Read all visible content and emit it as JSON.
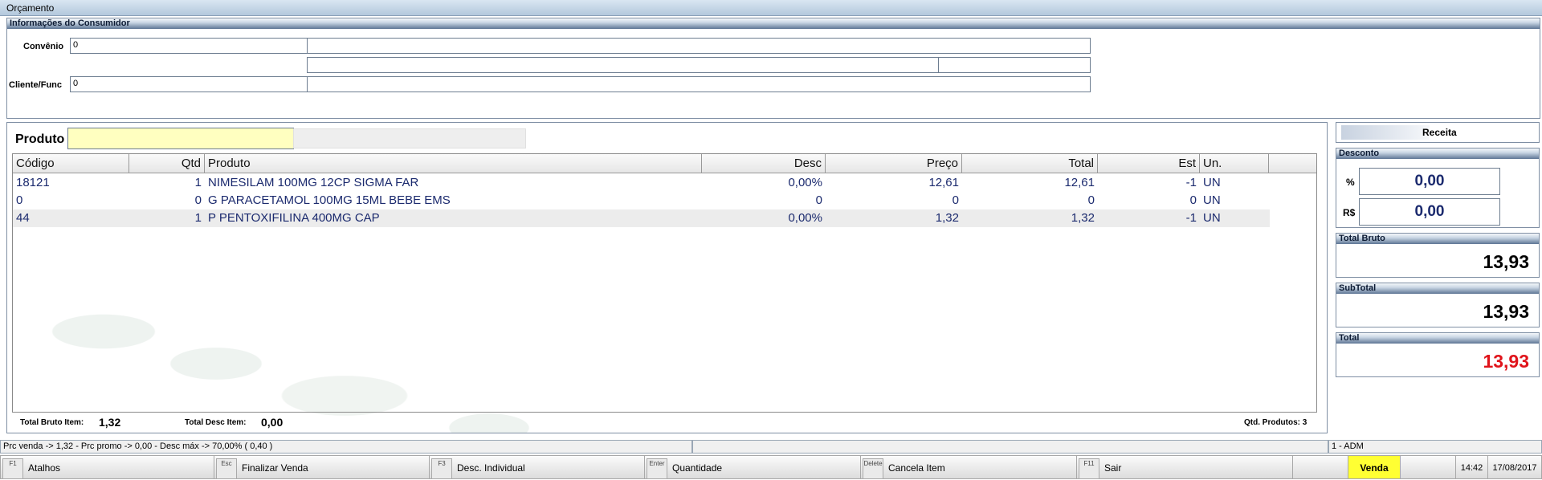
{
  "window": {
    "title": "Orçamento"
  },
  "consumer": {
    "header": "Informações do Consumidor",
    "convenio_label": "Convênio",
    "convenio_value": "0",
    "cliente_label": "Cliente/Func",
    "cliente_value": "0"
  },
  "produto": {
    "label": "Produto",
    "value": ""
  },
  "table": {
    "columns": [
      "Código",
      "Qtd",
      "Produto",
      "Desc",
      "Preço",
      "Total",
      "Est",
      "Un."
    ],
    "rows": [
      [
        "18121",
        "1",
        "NIMESILAM 100MG 12CP SIGMA FAR",
        "0,00%",
        "12,61",
        "12,61",
        "-1",
        "UN"
      ],
      [
        "0",
        "0",
        "G PARACETAMOL 100MG 15ML BEBE EMS",
        "0",
        "0",
        "0",
        "0",
        "UN"
      ],
      [
        "44",
        "1",
        "P PENTOXIFILINA 400MG CAP",
        "0,00%",
        "1,32",
        "1,32",
        "-1",
        "UN"
      ]
    ]
  },
  "footer": {
    "total_bruto_item_label": "Total Bruto Item:",
    "total_bruto_item_value": "1,32",
    "total_desc_item_label": "Total Desc Item:",
    "total_desc_item_value": "0,00",
    "qtd_produtos": "Qtd. Produtos: 3"
  },
  "side": {
    "receita_label": "Receita",
    "desconto_header": "Desconto",
    "pct_label": "%",
    "pct_value": "0,00",
    "rs_label": "R$",
    "rs_value": "0,00",
    "total_bruto_header": "Total Bruto",
    "total_bruto_value": "13,93",
    "subtotal_header": "SubTotal",
    "subtotal_value": "13,93",
    "total_header": "Total",
    "total_value": "13,93"
  },
  "statusbar": {
    "price_info": "Prc venda -> 1,32 - Prc promo -> 0,00 - Desc máx -> 70,00% ( 0,40 )",
    "user": "1 - ADM"
  },
  "fkeys": [
    {
      "key": "F1",
      "label": "Atalhos"
    },
    {
      "key": "Esc",
      "label": "Finalizar Venda"
    },
    {
      "key": "F3",
      "label": "Desc. Individual"
    },
    {
      "key": "Enter",
      "label": "Quantidade"
    },
    {
      "key": "Delete",
      "label": "Cancela Item"
    },
    {
      "key": "F11",
      "label": "Sair"
    }
  ],
  "mode": "Venda",
  "time": "14:42",
  "date": "17/08/2017",
  "colors": {
    "accent_total": "#e0141b",
    "highlight_input": "#ffffc0",
    "mode_bg": "#ffff33"
  }
}
